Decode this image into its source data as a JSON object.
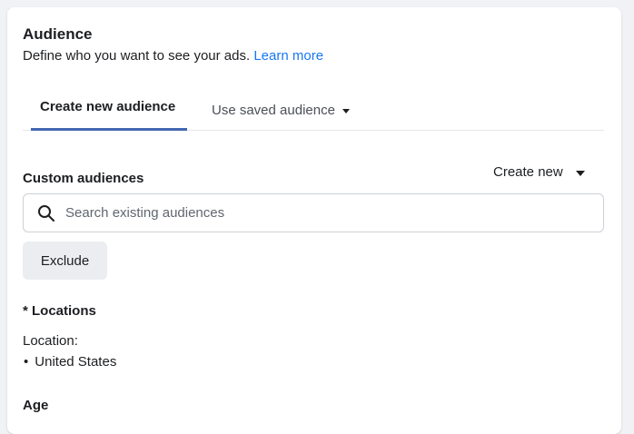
{
  "audience": {
    "title": "Audience",
    "subtitle": "Define who you want to see your ads.",
    "learn_more": "Learn more"
  },
  "tabs": [
    {
      "label": "Create new audience",
      "active": true
    },
    {
      "label": "Use saved audience",
      "active": false
    }
  ],
  "custom_audiences": {
    "label": "Custom audiences",
    "create_new": "Create new",
    "search_placeholder": "Search existing audiences",
    "exclude_label": "Exclude"
  },
  "locations": {
    "label": "* Locations",
    "key": "Location:",
    "items": [
      "United States"
    ]
  },
  "age": {
    "label": "Age"
  },
  "colors": {
    "link": "#1877f2",
    "tab_indicator": "#4267b2",
    "button_bg": "#ebedf0"
  }
}
